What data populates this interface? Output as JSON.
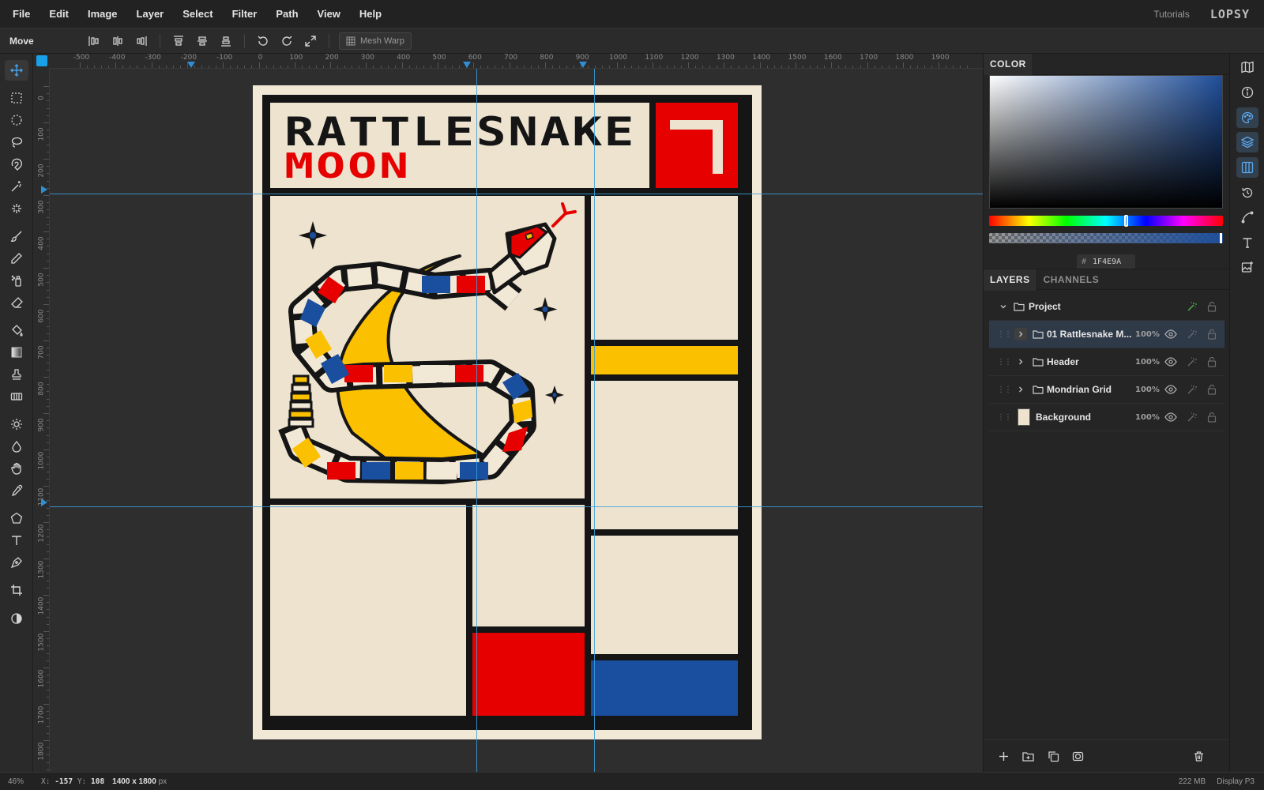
{
  "menubar": {
    "items": [
      "File",
      "Edit",
      "Image",
      "Layer",
      "Select",
      "Filter",
      "Path",
      "View",
      "Help"
    ],
    "tutorials": "Tutorials",
    "brand": "LOPSY"
  },
  "optionsbar": {
    "tool_name": "Move",
    "mesh_warp_label": "Mesh Warp"
  },
  "ruler": {
    "h_labels": [
      "-500",
      "-400",
      "-300",
      "-200",
      "-100",
      "0",
      "100",
      "200",
      "300",
      "400",
      "500",
      "600",
      "700",
      "800",
      "900",
      "1000",
      "1100",
      "1200",
      "1300",
      "1400",
      "1500",
      "1600",
      "1700",
      "1800",
      "1900"
    ],
    "v_labels": [
      "0",
      "100",
      "200",
      "300",
      "400",
      "500",
      "600",
      "700",
      "800",
      "900",
      "1000",
      "1100",
      "1200",
      "1300",
      "1400",
      "1500",
      "1600",
      "1700",
      "1800"
    ]
  },
  "artwork": {
    "title_line1": "RATTLESNAKE",
    "title_line2": "MOON"
  },
  "color_panel": {
    "tab_label": "COLOR",
    "hex_hash": "#",
    "hex_value": "1F4E9A",
    "current_color": "#1f4e9a"
  },
  "layers_panel": {
    "tabs": [
      "LAYERS",
      "CHANNELS"
    ],
    "project_label": "Project",
    "layers": [
      {
        "name": "01 Rattlesnake M...",
        "opacity": "100%"
      },
      {
        "name": "Header",
        "opacity": "100%"
      },
      {
        "name": "Mondrian Grid",
        "opacity": "100%"
      },
      {
        "name": "Background",
        "opacity": "100%"
      }
    ]
  },
  "status": {
    "zoom": "46%",
    "x_label": "X:",
    "x_value": "-157",
    "y_label": "Y:",
    "y_value": "108",
    "dimensions": "1400 x 1800",
    "dimensions_unit": "px",
    "memory": "222 MB",
    "color_profile": "Display P3"
  },
  "colors": {
    "accent": "#18a0e8",
    "mondrian_red": "#e60000",
    "mondrian_blue": "#1a4fa0",
    "mondrian_yellow": "#fbc100",
    "paper": "#ede3cf"
  }
}
